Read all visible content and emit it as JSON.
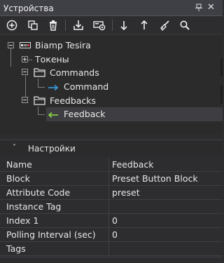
{
  "panel": {
    "title": "Устройства"
  },
  "toolbar": {
    "buttons": [
      {
        "icon": "add-circle-icon"
      },
      {
        "icon": "copy-icon"
      },
      {
        "icon": "delete-icon"
      },
      {
        "icon": "import-icon"
      },
      {
        "icon": "device-settings-icon"
      },
      {
        "icon": "arrow-down-icon"
      },
      {
        "icon": "arrow-up-icon"
      },
      {
        "icon": "broom-icon"
      },
      {
        "icon": "search-icon"
      }
    ]
  },
  "tree": {
    "device": "Biamp Tesira",
    "tokens": "Токены",
    "commands": "Commands",
    "command": "Command",
    "feedbacks": "Feedbacks",
    "feedback": "Feedback"
  },
  "properties": {
    "header": "Настройки",
    "rows": [
      {
        "name": "Name",
        "value": "Feedback"
      },
      {
        "name": "Block",
        "value": "Preset Button Block"
      },
      {
        "name": "Attribute Code",
        "value": "preset"
      },
      {
        "name": "Instance Tag",
        "value": ""
      },
      {
        "name": "Index 1",
        "value": "0"
      },
      {
        "name": "Polling Interval (sec)",
        "value": "0"
      },
      {
        "name": "Tags",
        "value": ""
      }
    ]
  },
  "colors": {
    "command_arrow": "#3aa0e6",
    "feedback_arrow": "#8bd34a",
    "selection": "#3e3e42"
  }
}
